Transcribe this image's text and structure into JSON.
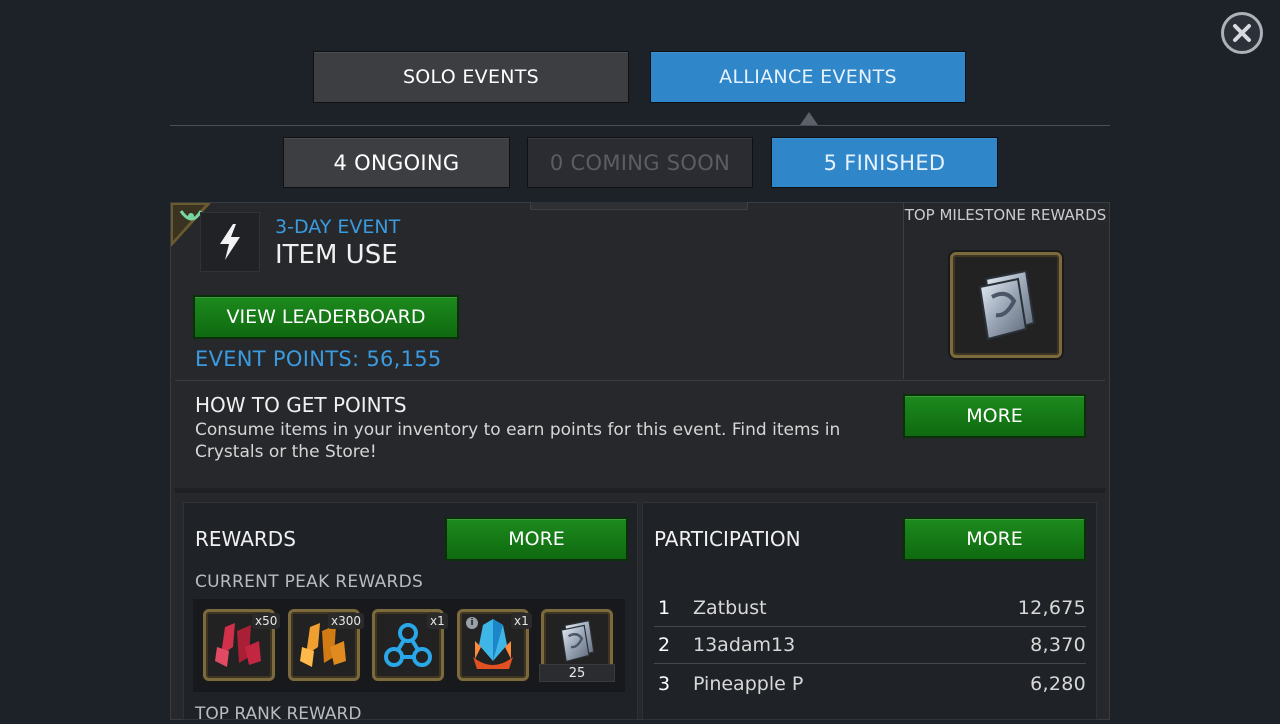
{
  "top_tabs": {
    "solo": "SOLO EVENTS",
    "alliance": "ALLIANCE EVENTS"
  },
  "sub_tabs": {
    "ongoing": "4 ONGOING",
    "coming_soon": "0 COMING SOON",
    "finished": "5 FINISHED"
  },
  "event": {
    "subtitle": "3-DAY EVENT",
    "title": "ITEM USE",
    "view_leaderboard": "VIEW LEADERBOARD",
    "points": "EVENT POINTS: 56,155",
    "icon": "lightning-bolt-icon"
  },
  "milestone": {
    "title": "TOP MILESTONE REWARDS",
    "reward_icon": "t4-basic-catalyst-icon"
  },
  "how_to": {
    "title": "HOW TO GET POINTS",
    "description": "Consume items in your inventory to earn points for this event. Find items in Crystals or the Store!",
    "more": "MORE"
  },
  "rewards": {
    "title": "REWARDS",
    "more": "MORE",
    "peak_label": "CURRENT PEAK REWARDS",
    "items": [
      {
        "icon": "red-shards-icon",
        "count": "x50"
      },
      {
        "icon": "gold-shards-icon",
        "count": "x300"
      },
      {
        "icon": "blue-node-icon",
        "count": "x1"
      },
      {
        "icon": "crystal-icon",
        "count": "x1"
      },
      {
        "icon": "catalyst-icon",
        "qty": "25"
      }
    ],
    "top_rank_label": "TOP RANK REWARD"
  },
  "participation": {
    "title": "PARTICIPATION",
    "more": "MORE",
    "rows": [
      {
        "rank": "1",
        "name": "Zatbust",
        "score": "12,675"
      },
      {
        "rank": "2",
        "name": "13adam13",
        "score": "8,370"
      },
      {
        "rank": "3",
        "name": "Pineapple P",
        "score": "6,280"
      }
    ]
  },
  "colors": {
    "accent_blue": "#2f86c8",
    "green_button": "#137a14",
    "panel": "#26282c"
  }
}
